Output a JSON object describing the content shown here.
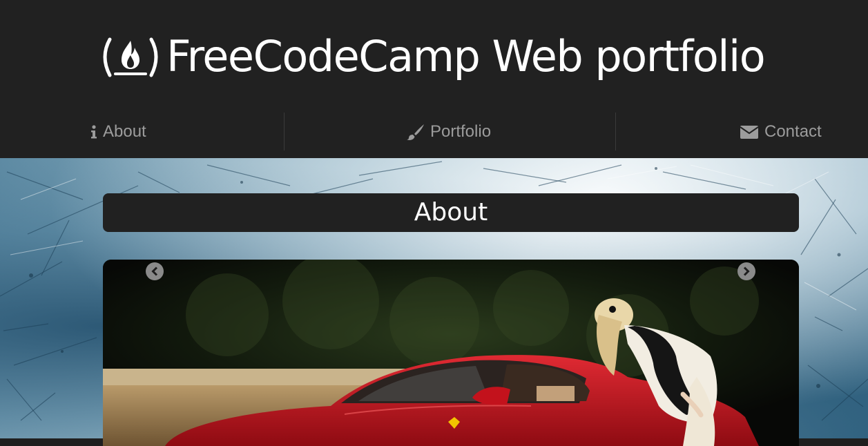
{
  "header": {
    "logo_icon": "freecodecamp-fire-icon",
    "title": "FreeCodeCamp Web portfolio"
  },
  "nav": {
    "items": [
      {
        "label": "About",
        "icon": "info-icon"
      },
      {
        "label": "Portfolio",
        "icon": "paintbrush-icon"
      },
      {
        "label": "Contact",
        "icon": "envelope-icon"
      }
    ]
  },
  "about": {
    "heading": "About"
  },
  "carousel": {
    "prev_icon": "chevron-left-circle-icon",
    "next_icon": "chevron-right-circle-icon",
    "slide_image": "red-ferrari-with-woman-photo"
  },
  "colors": {
    "header_bg": "#212121",
    "nav_text": "#9c9c9c",
    "title_text": "#ffffff",
    "car_red": "#c3121c"
  }
}
